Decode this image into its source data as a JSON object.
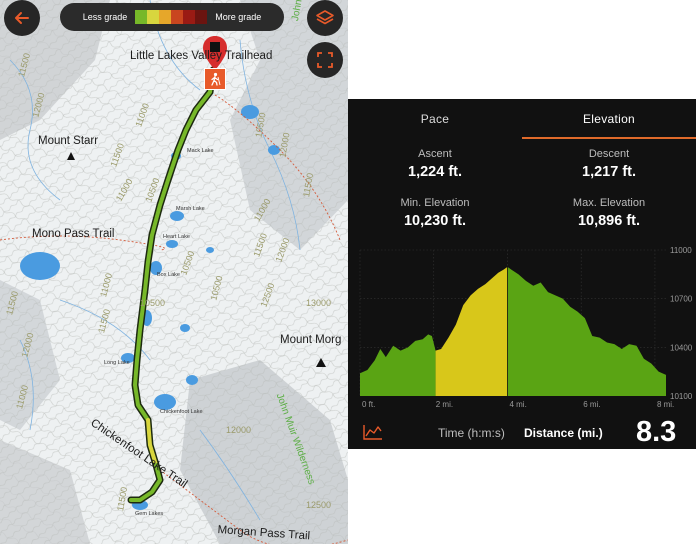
{
  "map": {
    "grade_legend": {
      "less_label": "Less grade",
      "more_label": "More grade",
      "colors": [
        "#77b829",
        "#d8d63e",
        "#e6a72a",
        "#c9461f",
        "#9a1b14",
        "#6b1410"
      ]
    },
    "place_labels": {
      "trailhead": "Little Lakes Valley Trailhead",
      "mount_starr": "Mount Starr",
      "mono_pass": "Mono Pass Trail",
      "mount_morgan": "Mount Morg",
      "chickenfoot_trail": "Chickenfoot Lake Trail",
      "morgan_pass": "Morgan Pass Trail",
      "wilderness": "John Muir Wilderness",
      "wilderness_top": "John"
    },
    "lake_labels": {
      "mack": "Mack Lake",
      "marsh": "Marsh Lake",
      "heart": "Heart Lake",
      "box": "Box Lake",
      "long": "Long Lake",
      "chickenfoot": "Chickenfoot Lake",
      "gem": "Gem Lakes"
    },
    "contour_labels": [
      "11500",
      "12000",
      "11000",
      "11500",
      "11000",
      "10500",
      "11000",
      "10500",
      "12000",
      "11500",
      "11000",
      "10500",
      "11500",
      "12000",
      "13000",
      "12500",
      "10500",
      "10500",
      "11500",
      "12000",
      "11000",
      "11500",
      "11000",
      "12000",
      "11500",
      "12500"
    ],
    "accent_color": "#e85a2a",
    "route_color": "#77b829",
    "steep_color": "#d8d63e"
  },
  "buttons": {
    "back": "back-arrow",
    "layers": "layers",
    "fullscreen": "fullscreen"
  },
  "panel": {
    "tabs": [
      {
        "label": "Pace"
      },
      {
        "label": "Elevation"
      }
    ],
    "active_tab": "Elevation",
    "stats": {
      "ascent": {
        "label": "Ascent",
        "value": "1,224 ft."
      },
      "descent": {
        "label": "Descent",
        "value": "1,217 ft."
      },
      "min_elev": {
        "label": "Min. Elevation",
        "value": "10,230 ft."
      },
      "max_elev": {
        "label": "Max. Elevation",
        "value": "10,896 ft."
      }
    },
    "bottom": {
      "time_label": "Time (h:m:s)",
      "distance_label": "Distance (mi.)",
      "distance_value": "8.3"
    }
  },
  "chart_data": {
    "type": "area",
    "title": "",
    "xlabel": "",
    "ylabel": "",
    "x_ticks": [
      "0 ft.",
      "2 mi.",
      "4 mi.",
      "6 mi.",
      "8 mi."
    ],
    "y_ticks": [
      "11000",
      "10700",
      "10400",
      "10100"
    ],
    "xlim": [
      0,
      8.3
    ],
    "ylim": [
      10100,
      11000
    ],
    "highlight_range": [
      2.05,
      4.0
    ],
    "highlight_color": "#d8c71a",
    "base_color": "#5aa414",
    "x": [
      0,
      0.2,
      0.4,
      0.55,
      0.7,
      0.9,
      1.1,
      1.3,
      1.5,
      1.7,
      1.85,
      1.95,
      2.05,
      2.2,
      2.4,
      2.6,
      2.8,
      3.0,
      3.2,
      3.4,
      3.6,
      3.75,
      3.9,
      4.0,
      4.1,
      4.3,
      4.5,
      4.7,
      4.9,
      5.1,
      5.3,
      5.5,
      5.7,
      5.9,
      6.1,
      6.3,
      6.5,
      6.7,
      6.9,
      7.1,
      7.3,
      7.5,
      7.7,
      7.9,
      8.1,
      8.3
    ],
    "y": [
      10240,
      10260,
      10320,
      10390,
      10340,
      10410,
      10380,
      10400,
      10440,
      10450,
      10480,
      10470,
      10380,
      10390,
      10460,
      10540,
      10660,
      10720,
      10760,
      10790,
      10830,
      10860,
      10880,
      10896,
      10880,
      10850,
      10810,
      10780,
      10800,
      10740,
      10720,
      10700,
      10650,
      10620,
      10580,
      10470,
      10460,
      10430,
      10420,
      10390,
      10420,
      10410,
      10330,
      10300,
      10250,
      10230
    ]
  }
}
